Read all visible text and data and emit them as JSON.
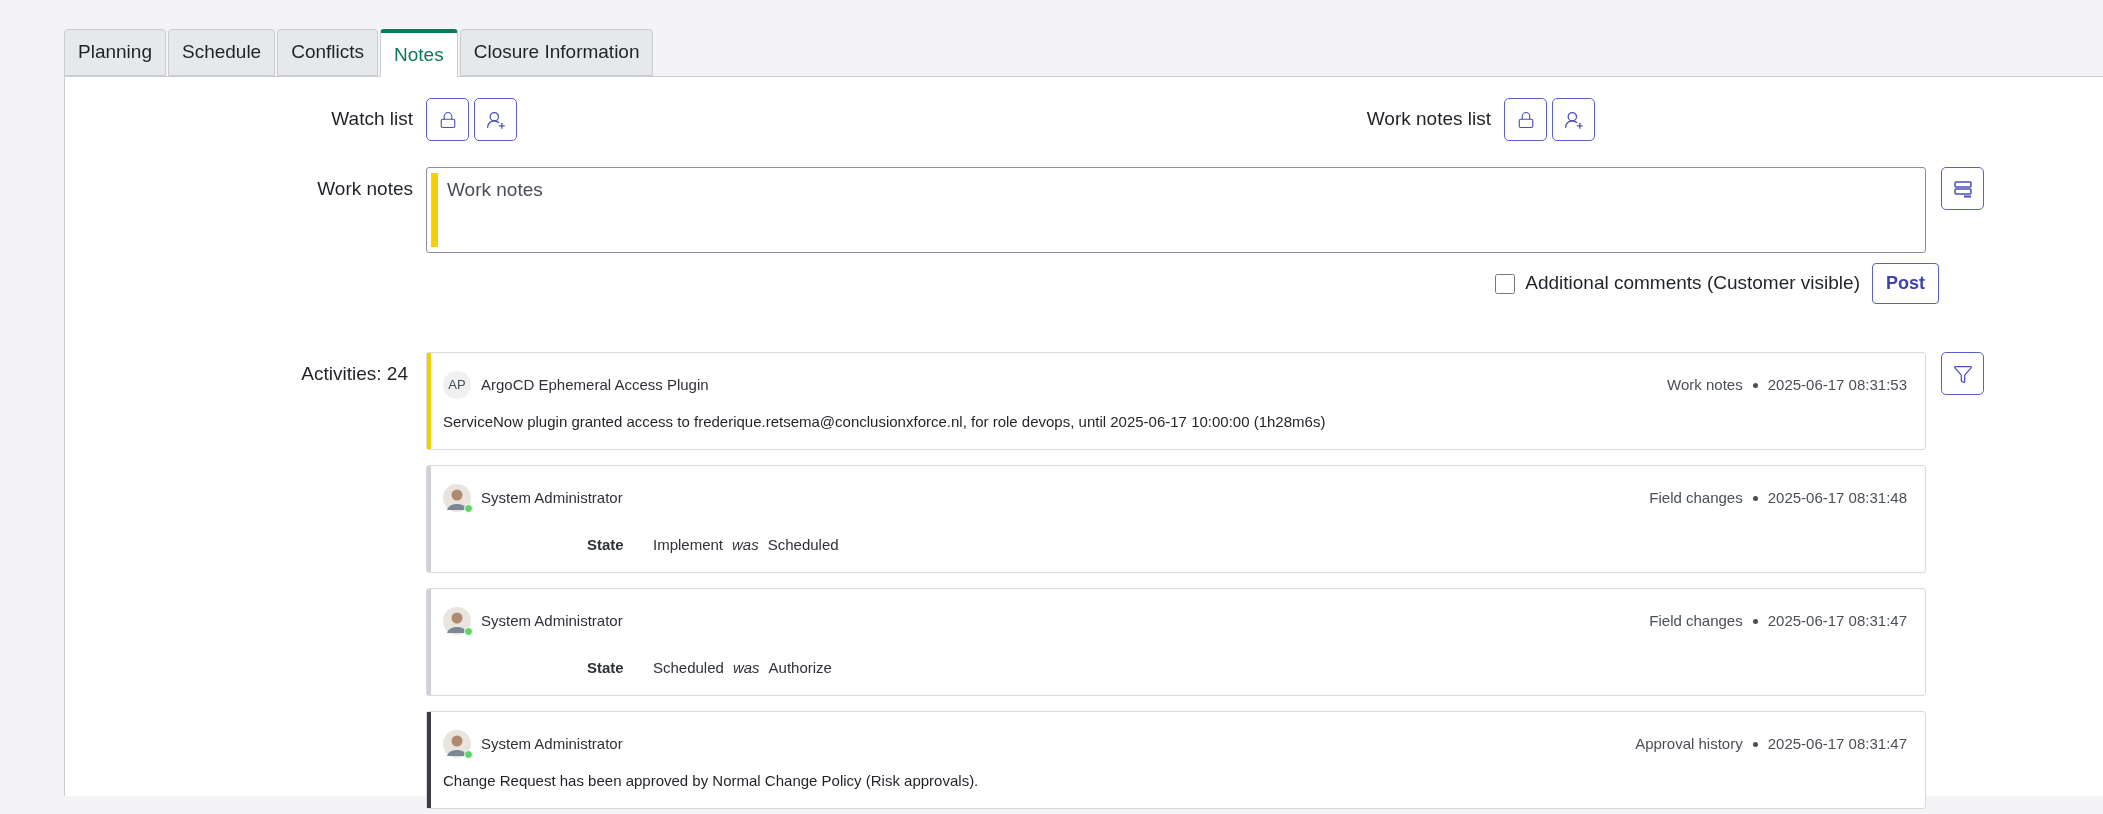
{
  "tabs": [
    {
      "label": "Planning",
      "selected": false
    },
    {
      "label": "Schedule",
      "selected": false
    },
    {
      "label": "Conflicts",
      "selected": false
    },
    {
      "label": "Notes",
      "selected": true
    },
    {
      "label": "Closure Information",
      "selected": false
    }
  ],
  "watch_list": {
    "label": "Watch list"
  },
  "work_notes_list": {
    "label": "Work notes list"
  },
  "work_notes": {
    "label": "Work notes",
    "placeholder": "Work notes",
    "required": true
  },
  "additional_comments": {
    "label": "Additional comments (Customer visible)",
    "checked": false
  },
  "post_button": "Post",
  "activities": {
    "label": "Activities: 24",
    "entries": [
      {
        "kind": "text",
        "color": "#f5d000",
        "author": "ArgoCD Ephemeral Access Plugin",
        "initials": "AP",
        "type": "Work notes",
        "time": "2025-06-17 08:31:53",
        "text": "ServiceNow plugin granted access to frederique.retsema@conclusionxforce.nl, for role devops, until 2025-06-17 10:00:00 (1h28m6s)"
      },
      {
        "kind": "field_change",
        "color": "#cfd3d8",
        "author": "System Administrator",
        "online": true,
        "type": "Field changes",
        "time": "2025-06-17 08:31:48",
        "field": "State",
        "new_value": "Implement",
        "was": "was",
        "old_value": "Scheduled"
      },
      {
        "kind": "field_change",
        "color": "#cfd3d8",
        "author": "System Administrator",
        "online": true,
        "type": "Field changes",
        "time": "2025-06-17 08:31:47",
        "field": "State",
        "new_value": "Scheduled",
        "was": "was",
        "old_value": "Authorize"
      },
      {
        "kind": "text",
        "color": "#3a3d42",
        "author": "System Administrator",
        "online": true,
        "type": "Approval history",
        "time": "2025-06-17 08:31:47",
        "text": "Change Request has been approved by Normal Change Policy (Risk approvals)."
      }
    ]
  }
}
